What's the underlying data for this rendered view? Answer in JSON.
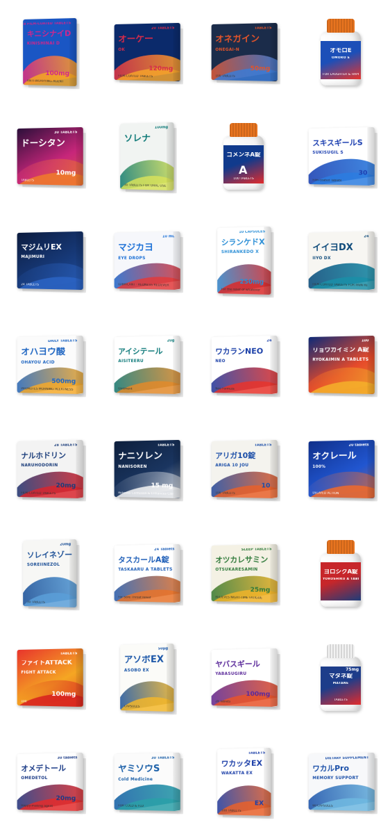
{
  "products": [
    {
      "kind": "box",
      "jp": "キニシナイD",
      "en": "KINISHINAI D",
      "top": "28 FILM-COATED TABLETS",
      "big": "100mg",
      "sub": "ANTI-WORRYING AGENT",
      "colors": [
        "#1a56c4",
        "#d0268d",
        "#f5a623"
      ]
    },
    {
      "kind": "box",
      "jp": "オーケー",
      "en": "OK",
      "top": "20 TABLETS",
      "big": "120mg",
      "sub": "FILM-COATED TABLETS",
      "colors": [
        "#0b2a6b",
        "#d62b4a",
        "#f4a32a"
      ]
    },
    {
      "kind": "box",
      "jp": "オネガイン",
      "en": "ONEGAI-N",
      "top": "TABLETS",
      "big": "50mg",
      "sub": "100 TABLETS",
      "colors": [
        "#1b2c4a",
        "#e3542a",
        "#3b7bd6"
      ]
    },
    {
      "kind": "bottle",
      "jp": "オモロE",
      "en": "OMORO E",
      "top": "",
      "big": "",
      "sub": "FOR LAUGHTER & HAPPINESS",
      "colors": [
        "#e6eef8",
        "#1c4fb8",
        "#e8342c"
      ]
    },
    {
      "kind": "box",
      "jp": "ドーシタン",
      "en": "",
      "top": "30 TABLETS",
      "big": "10mg",
      "sub": "TABLETS",
      "colors": [
        "#2b0f3a",
        "#c7267a",
        "#f07b2a"
      ]
    },
    {
      "kind": "box",
      "jp": "ソレナ",
      "en": "",
      "top": "100mg",
      "big": "",
      "sub": "30 TABLETS FOR ORAL USE",
      "colors": [
        "#f1f4f2",
        "#0f7a78",
        "#d7e25a"
      ]
    },
    {
      "kind": "bottle",
      "jp": "ゴメンネA錠",
      "en": "",
      "top": "",
      "big": "A",
      "sub": "100 TABLETS",
      "colors": [
        "#e8741f",
        "#103a8c",
        "#e32b2b"
      ]
    },
    {
      "kind": "box",
      "jp": "スキスギールS",
      "en": "SUKISUGIL S",
      "top": "",
      "big": "30",
      "sub": "Film-coated Tablets",
      "colors": [
        "#ffffff",
        "#1c3fb0",
        "#2b7de0"
      ]
    },
    {
      "kind": "box",
      "jp": "マジムリEX",
      "en": "MAJIMURI",
      "top": "",
      "big": "",
      "sub": "24 TABLETS",
      "colors": [
        "#0c1c3f",
        "#173a7a",
        "#2c64c4"
      ]
    },
    {
      "kind": "box",
      "jp": "マジカヨ",
      "en": "EYE DROPS",
      "top": "10 mL",
      "big": "",
      "sub": "LUBRICANT · REDNESS RELIEVER",
      "colors": [
        "#f6f7fb",
        "#1a6fd6",
        "#e23b3b"
      ]
    },
    {
      "kind": "box",
      "jp": "シランケドX",
      "en": "SHIRANKEDO X",
      "top": "10 CAPSULES",
      "big": "250mg",
      "sub": "For the relief of whatever",
      "colors": [
        "#ffffff",
        "#2a8ed6",
        "#d92a2a"
      ]
    },
    {
      "kind": "box",
      "jp": "イイヨDX",
      "en": "IIYO DX",
      "top": "24",
      "big": "",
      "sub": "FILM-COATED TABLETS FOR PAIN RELIEF",
      "colors": [
        "#f7f6f2",
        "#0e4a7a",
        "#1a8fa8"
      ]
    },
    {
      "kind": "box",
      "jp": "オハヨウ酸",
      "en": "OHAYOU ACID",
      "top": "DAILY TABLETS",
      "big": "500mg",
      "sub": "PROMOTES MORNING ALERTNESS",
      "colors": [
        "#fbfbfb",
        "#1f66c2",
        "#f4a92a"
      ]
    },
    {
      "kind": "box",
      "jp": "アイシテール",
      "en": "AISITEERU",
      "top": "20g",
      "big": "",
      "sub": "Ointment",
      "colors": [
        "#ffffff",
        "#0e7a7a",
        "#e28a2a"
      ]
    },
    {
      "kind": "box",
      "jp": "ワカランNEO",
      "en": "NEO",
      "top": "24",
      "big": "",
      "sub": "Neo Formula",
      "colors": [
        "#ffffff",
        "#1a3fa8",
        "#e8342c"
      ]
    },
    {
      "kind": "box",
      "jp": "リョウカイミン A錠",
      "en": "RYOKAIMIN A TABLETS",
      "top": "100",
      "big": "",
      "sub": "",
      "colors": [
        "#0d2a78",
        "#e64a2a",
        "#f4b02a"
      ]
    },
    {
      "kind": "box",
      "jp": "ナルホドリン",
      "en": "NARUHODORIN",
      "top": "28 TABLETS",
      "big": "20mg",
      "sub": "FILM-COATED TABLETS",
      "colors": [
        "#f3f3f3",
        "#1a3c7a",
        "#d8262e"
      ]
    },
    {
      "kind": "box",
      "jp": "ナニソレン",
      "en": "NANISOREN",
      "top": "TABLETS",
      "big": "15 mg",
      "sub": "Relieves Confusion & Enhances Clarity",
      "colors": [
        "#0d1f3c",
        "#1a3560",
        "#f4f4f4"
      ]
    },
    {
      "kind": "box",
      "jp": "アリガ10錠",
      "en": "ARIGA 10 JOU",
      "top": "TABLETS",
      "big": "10",
      "sub": "100 TABLETS",
      "colors": [
        "#f4f3ee",
        "#1b4ea8",
        "#e8602a"
      ]
    },
    {
      "kind": "box",
      "jp": "オクレール",
      "en": "100%",
      "top": "20 tablets",
      "big": "",
      "sub": "DELAYED ACTION",
      "colors": [
        "#0f2f8a",
        "#2156d0",
        "#f06a2a"
      ]
    },
    {
      "kind": "box",
      "jp": "ソレイネゾール",
      "en": "SOREIINEZOL",
      "top": "20mg",
      "big": "",
      "sub": "30 TABLETS",
      "colors": [
        "#f7f7f5",
        "#1c4f96",
        "#5a9fd8"
      ]
    },
    {
      "kind": "box",
      "jp": "タスカールA錠",
      "en": "TASKAARU A TABLETS",
      "top": "24 Tablets",
      "big": "",
      "sub": "For Sore Throat Relief",
      "colors": [
        "#ffffff",
        "#1f5fb8",
        "#e8732a"
      ]
    },
    {
      "kind": "box",
      "jp": "オツカレサミン",
      "en": "OTSUKARESAMIN",
      "top": "SLEEP TABLETS",
      "big": "25mg",
      "sub": "RELIEVES NIGHT-TIME FATIGUE",
      "colors": [
        "#f4f1e4",
        "#2f7a3a",
        "#f0b329"
      ]
    },
    {
      "kind": "bottle",
      "jp": "ヨロシクA錠",
      "en": "YOROSHIKU A TABLETS",
      "top": "",
      "big": "",
      "sub": "",
      "colors": [
        "#e8561f",
        "#c7262a",
        "#1e3c7a"
      ]
    },
    {
      "kind": "box",
      "jp": "ファイトATTACK",
      "en": "FIGHT ATTACK",
      "top": "TABLETS",
      "big": "100mg",
      "sub": "100",
      "colors": [
        "#e8342c",
        "#f5a623",
        "#d71f1f"
      ]
    },
    {
      "kind": "box",
      "jp": "アソボEX",
      "en": "ASOBO EX",
      "top": "50μg",
      "big": "",
      "sub": "CAPSULES",
      "colors": [
        "#fbfbf8",
        "#1a56a8",
        "#f2b62a"
      ]
    },
    {
      "kind": "box",
      "jp": "ヤバスギール",
      "en": "YABASUGIRU",
      "top": "",
      "big": "100mg",
      "sub": "28 Tablets",
      "colors": [
        "#ffffff",
        "#5b2a9a",
        "#e8542a"
      ]
    },
    {
      "kind": "bottle",
      "jp": "マタネ錠",
      "en": "MATANE",
      "top": "75mg",
      "big": "",
      "sub": "TABLETS",
      "colors": [
        "#ffffff",
        "#1d3d8a",
        "#e32b2b"
      ]
    },
    {
      "kind": "box",
      "jp": "オメデトール",
      "en": "OMEDETOL",
      "top": "30 tablets",
      "big": "20mg",
      "sub": "Happy-making agent",
      "colors": [
        "#ffffff",
        "#1a3a86",
        "#e32b2b"
      ]
    },
    {
      "kind": "box",
      "jp": "ヤミソウS",
      "en": "Cold Medicine",
      "top": "30 TABLETS",
      "big": "",
      "sub": "FOR COLD & FLU",
      "colors": [
        "#fbfbfb",
        "#1a5fa8",
        "#2aa0a8"
      ]
    },
    {
      "kind": "box",
      "jp": "ワカッタEX",
      "en": "WAKATTA EX",
      "top": "TABLETS",
      "big": "EX",
      "sub": "100 TABLETS",
      "colors": [
        "#ffffff",
        "#1c3fa8",
        "#e8602a"
      ]
    },
    {
      "kind": "box",
      "jp": "ワカルPro",
      "en": "MEMORY SUPPORT",
      "top": "DIETARY SUPPLEMENT",
      "big": "",
      "sub": "60 CAPSULES",
      "colors": [
        "#f7f8fa",
        "#1b4fa8",
        "#6fb8e0"
      ]
    }
  ]
}
